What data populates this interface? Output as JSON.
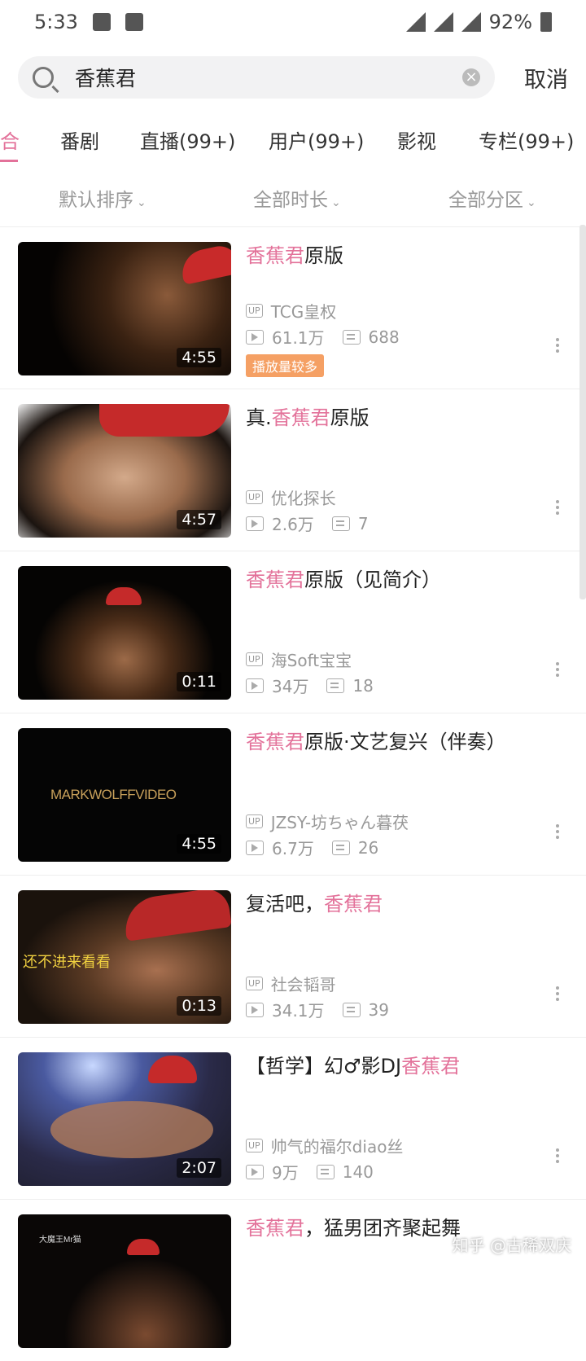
{
  "status": {
    "time": "5:33",
    "battery": "92%"
  },
  "search": {
    "query": "香蕉君",
    "cancel": "取消"
  },
  "tabs": [
    "合",
    "番剧",
    "直播(99+)",
    "用户(99+)",
    "影视",
    "专栏(99+)"
  ],
  "filters": [
    "默认排序",
    "全部时长",
    "全部分区"
  ],
  "results": [
    {
      "title_hl": "香蕉君",
      "title_post": "原版",
      "uploader": "TCG皇权",
      "views": "61.1万",
      "danmaku": "688",
      "duration": "4:55",
      "badge": "播放量较多"
    },
    {
      "title_pre": "真.",
      "title_hl": "香蕉君",
      "title_post": "原版",
      "uploader": "优化探长",
      "views": "2.6万",
      "danmaku": "7",
      "duration": "4:57"
    },
    {
      "title_hl": "香蕉君",
      "title_post": "原版（见简介）",
      "uploader": "海Soft宝宝",
      "views": "34万",
      "danmaku": "18",
      "duration": "0:11"
    },
    {
      "title_hl": "香蕉君",
      "title_post": "原版·文艺复兴（伴奏）",
      "uploader": "JZSY-坊ちゃん暮茯",
      "views": "6.7万",
      "danmaku": "26",
      "duration": "4:55",
      "thumb_text": "MARKWOLFFVIDEO"
    },
    {
      "title_pre": "复活吧，",
      "title_hl": "香蕉君",
      "uploader": "社会韬哥",
      "views": "34.1万",
      "danmaku": "39",
      "duration": "0:13",
      "thumb_text": "还不进来看看"
    },
    {
      "title_pre": "【哲学】幻♂影DJ",
      "title_hl": "香蕉君",
      "uploader": "帅气的福尔diao丝",
      "views": "9万",
      "danmaku": "140",
      "duration": "2:07"
    },
    {
      "title_hl": "香蕉君",
      "title_post": "，猛男团齐聚起舞",
      "thumb_text": "大魔王Mr猫"
    }
  ],
  "watermark": "知乎 @古稀双庆",
  "icons": [
    "image-icon",
    "download-icon",
    "wifi-icon",
    "signal-icon",
    "battery-icon",
    "search-icon",
    "clear-icon",
    "uploader-icon",
    "play-icon",
    "danmaku-icon",
    "more-icon"
  ]
}
